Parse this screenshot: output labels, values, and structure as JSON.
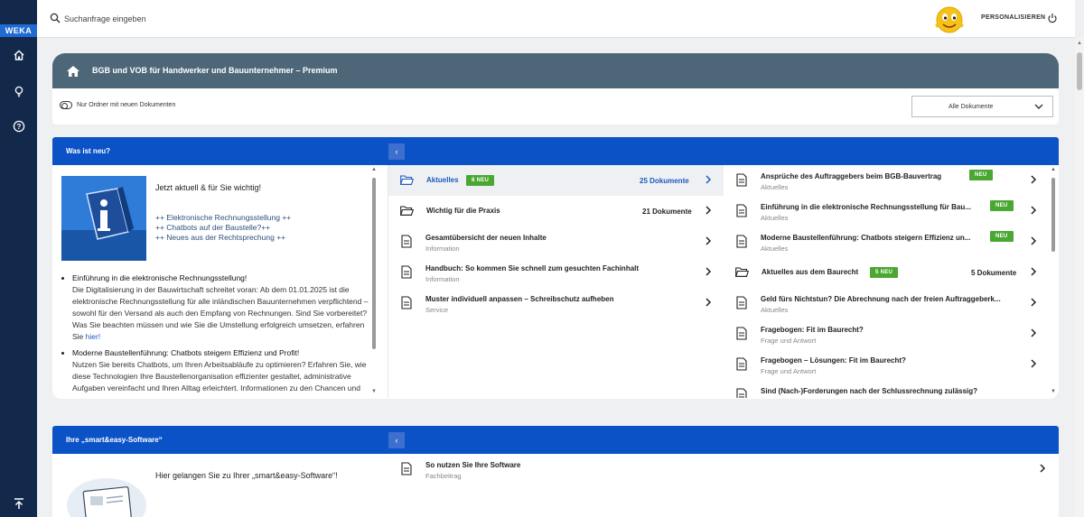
{
  "sidebar": {
    "logo": "WEKA"
  },
  "topbar": {
    "search_placeholder": "Suchanfrage eingeben",
    "personalize": "PERSONALISIEREN"
  },
  "hero": {
    "title": "BGB und VOB für Handwerker und Bauunternehmer – Premium",
    "toggle_label": "Nur Ordner mit neuen Dokumenten",
    "filter": "Alle Dokumente"
  },
  "news": {
    "title": "Was ist neu?",
    "intro": "Jetzt aktuell & für Sie wichtig!",
    "ticker": [
      "++ Elektronische Rechnungsstellung ++",
      "++ Chatbots auf der Baustelle?++",
      "++ Neues aus der Rechtsprechung ++"
    ],
    "bullets": [
      {
        "heading": "Einführung in die elektronische Rechnungsstellung!",
        "text": "Die Digitalisierung in der Bauwirtschaft schreitet voran: Ab dem 01.01.2025 ist die elektronische Rechnungsstellung für alle inländischen Bauunternehmen verpflichtend – sowohl für den Versand als auch den Empfang von Rechnungen. Sind Sie vorbereitet? Was Sie beachten müssen und wie Sie die Umstellung erfolgreich umsetzen, erfahren Sie",
        "link": "hier!"
      },
      {
        "heading": "Moderne Baustellenführung: Chatbots steigern Effizienz und Profit!",
        "text": "Nutzen Sie bereits Chatbots, um Ihren Arbeitsabläufe zu optimieren? Erfahren Sie, wie diese Technologien Ihre Baustellenorganisation effizienter gestaltet, administrative Aufgaben vereinfacht und Ihren Alltag erleichtert. Informationen zu den Chancen und Risiken sowie praxisnahe Tipps für den erfolgreichen",
        "link": ""
      }
    ],
    "middle": [
      {
        "type": "folder",
        "title": "Aktuelles",
        "badge": "8 NEU",
        "count": "25 Dokumente"
      },
      {
        "type": "folder",
        "title": "Wichtig für die Praxis",
        "count": "21 Dokumente"
      },
      {
        "type": "doc",
        "title": "Gesamtübersicht der neuen Inhalte",
        "sub": "Information"
      },
      {
        "type": "doc",
        "title": "Handbuch: So kommen Sie schnell zum gesuchten Fachinhalt",
        "sub": "Information"
      },
      {
        "type": "doc",
        "title": "Muster individuell anpassen – Schreibschutz aufheben",
        "sub": "Service"
      }
    ],
    "right": [
      {
        "type": "doc",
        "title": "Ansprüche des Auftraggebers beim BGB-Bauvertrag",
        "sub": "Aktuelles",
        "badge": "NEU"
      },
      {
        "type": "doc",
        "title": "Einführung in die elektronische Rechnungsstellung für Bau...",
        "sub": "Aktuelles",
        "badge": "NEU"
      },
      {
        "type": "doc",
        "title": "Moderne Baustellenführung: Chatbots steigern Effizienz un...",
        "sub": "Aktuelles",
        "badge": "NEU"
      },
      {
        "type": "folder",
        "title": "Aktuelles aus dem Baurecht",
        "badge": "5 NEU",
        "count": "5 Dokumente"
      },
      {
        "type": "doc",
        "title": "Geld fürs Nichtstun? Die Abrechnung nach der freien Auftraggeberk...",
        "sub": "Aktuelles"
      },
      {
        "type": "doc",
        "title": "Fragebogen: Fit im Baurecht?",
        "sub": "Frage und Antwort"
      },
      {
        "type": "doc",
        "title": "Fragebogen – Lösungen: Fit im Baurecht?",
        "sub": "Frage und Antwort"
      },
      {
        "type": "doc",
        "title": "Sind (Nach-)Forderungen nach der Schlussrechnung zulässig?",
        "sub": ""
      }
    ]
  },
  "software": {
    "title": "Ihre „smart&easy-Software“",
    "intro": "Hier gelangen Sie zu Ihrer „smart&easy-Software“!",
    "items": [
      {
        "type": "doc",
        "title": "So nutzen Sie Ihre Software",
        "sub": "Fachbeitrag"
      }
    ]
  }
}
